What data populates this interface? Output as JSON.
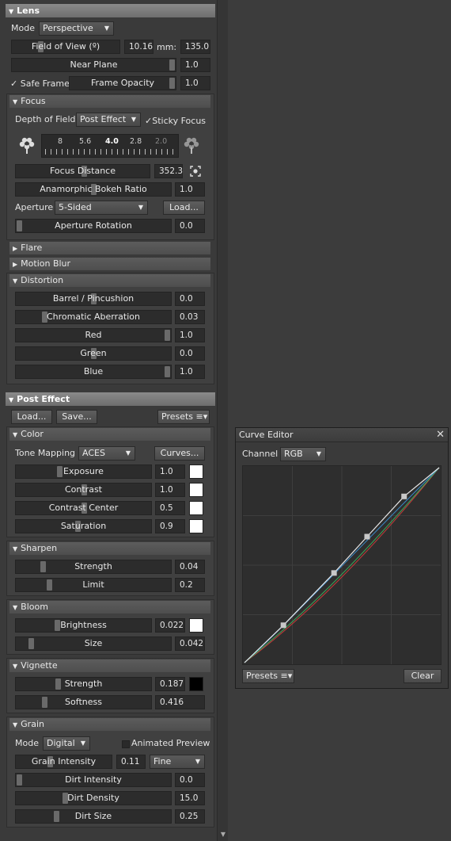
{
  "lens": {
    "title": "Lens",
    "mode_label": "Mode",
    "mode_value": "Perspective",
    "fov_label": "Field of View (º)",
    "fov_value": "10.16",
    "mm_label": "mm:",
    "mm_value": "135.0",
    "near_label": "Near Plane",
    "near_value": "1.0",
    "safe_frame_label": "Safe Frame",
    "opacity_label": "Frame Opacity",
    "opacity_value": "1.0"
  },
  "focus": {
    "title": "Focus",
    "dof_label": "Depth of Field",
    "dof_value": "Post Effect",
    "sticky_label": "Sticky Focus",
    "fstops": [
      "8",
      "5.6",
      "4.0",
      "2.8",
      "2.0"
    ],
    "distance_label": "Focus Distance",
    "distance_value": "352.3",
    "bokeh_label": "Anamorphic Bokeh Ratio",
    "bokeh_value": "1.0",
    "aperture_label": "Aperture",
    "aperture_value": "5-Sided",
    "load_label": "Load...",
    "rotation_label": "Aperture Rotation",
    "rotation_value": "0.0"
  },
  "flare": {
    "title": "Flare"
  },
  "motion_blur": {
    "title": "Motion Blur"
  },
  "distortion": {
    "title": "Distortion",
    "barrel_label": "Barrel / Pincushion",
    "barrel_value": "0.0",
    "chroma_label": "Chromatic Aberration",
    "chroma_value": "0.03",
    "red_label": "Red",
    "red_value": "1.0",
    "green_label": "Green",
    "green_value": "0.0",
    "blue_label": "Blue",
    "blue_value": "1.0"
  },
  "post": {
    "title": "Post Effect",
    "load_label": "Load...",
    "save_label": "Save...",
    "presets_label": "Presets"
  },
  "color": {
    "title": "Color",
    "tone_label": "Tone Mapping",
    "tone_value": "ACES",
    "curves_label": "Curves...",
    "exposure_label": "Exposure",
    "exposure_value": "1.0",
    "contrast_label": "Contrast",
    "contrast_value": "1.0",
    "center_label": "Contrast Center",
    "center_value": "0.5",
    "saturation_label": "Saturation",
    "saturation_value": "0.9"
  },
  "sharpen": {
    "title": "Sharpen",
    "strength_label": "Strength",
    "strength_value": "0.04",
    "limit_label": "Limit",
    "limit_value": "0.2"
  },
  "bloom": {
    "title": "Bloom",
    "brightness_label": "Brightness",
    "brightness_value": "0.022",
    "size_label": "Size",
    "size_value": "0.042"
  },
  "vignette": {
    "title": "Vignette",
    "strength_label": "Strength",
    "strength_value": "0.187",
    "softness_label": "Softness",
    "softness_value": "0.416"
  },
  "grain": {
    "title": "Grain",
    "mode_label": "Mode",
    "mode_value": "Digital",
    "animated_label": "Animated Preview",
    "intensity_label": "Grain Intensity",
    "intensity_value": "0.11",
    "quality_value": "Fine",
    "dirt_intensity_label": "Dirt Intensity",
    "dirt_intensity_value": "0.0",
    "dirt_density_label": "Dirt Density",
    "dirt_density_value": "15.0",
    "dirt_size_label": "Dirt Size",
    "dirt_size_value": "0.25"
  },
  "curve_editor": {
    "title": "Curve Editor",
    "channel_label": "Channel",
    "channel_value": "RGB",
    "presets_label": "Presets",
    "clear_label": "Clear",
    "curve_points": [
      [
        0,
        0
      ],
      [
        0.2,
        0.2
      ],
      [
        0.46,
        0.46
      ],
      [
        0.63,
        0.63
      ],
      [
        0.82,
        0.82
      ],
      [
        1,
        1
      ]
    ]
  },
  "colors": {
    "white_curve": "#e8e8e8",
    "red_curve": "#c83a3a",
    "green_curve": "#3aa85a",
    "blue_curve": "#3a8ac8"
  }
}
